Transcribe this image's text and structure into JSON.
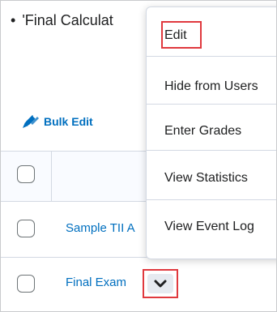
{
  "header": {
    "bullet": "•",
    "text": "'Final Calculat"
  },
  "toolbar": {
    "bulk_edit_label": "Bulk Edit",
    "bulk_edit_icon": "pencil-edit-icon"
  },
  "table": {
    "rows": [
      {
        "label": "Sample TII A"
      },
      {
        "label": "Final Exam"
      }
    ]
  },
  "context_menu": {
    "items": [
      "Edit",
      "Hide from Users",
      "Enter Grades",
      "View Statistics",
      "View Event Log"
    ]
  },
  "colors": {
    "link": "#006fbf",
    "highlight": "#e0393e",
    "border": "#d3d9e3"
  }
}
